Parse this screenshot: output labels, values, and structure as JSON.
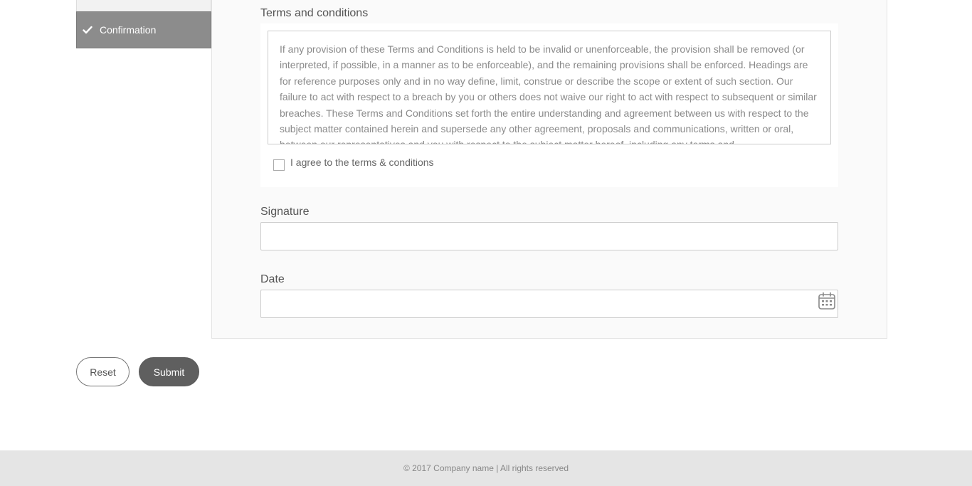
{
  "sidebar": {
    "active_item": {
      "label": "Confirmation",
      "icon": "check-icon"
    }
  },
  "terms": {
    "label": "Terms and conditions",
    "text": "If any provision of these Terms and Conditions is held to be invalid or unenforceable, the provision shall be removed (or interpreted, if possible, in a manner as to be enforceable), and the remaining provisions shall be enforced. Headings are for reference purposes only and in no way define, limit, construe or describe the scope or extent of such section. Our failure to act with respect to a breach by you or others does not waive our right to act with respect to subsequent or similar breaches. These Terms and Conditions set forth the entire understanding and agreement between us with respect to the subject matter contained herein and supersede any other agreement, proposals and communications, written or oral, between our representatives and you with respect to the subject matter hereof, including any terms and",
    "agree_label": "I agree to the terms & conditions",
    "agree_checked": false
  },
  "signature": {
    "label": "Signature",
    "value": "",
    "placeholder": ""
  },
  "date": {
    "label": "Date",
    "value": "",
    "placeholder": "",
    "icon": "calendar-icon"
  },
  "actions": {
    "reset_label": "Reset",
    "submit_label": "Submit"
  },
  "footer": {
    "text": "© 2017 Company name | All rights reserved"
  },
  "colors": {
    "sidebar_active_bg": "#8c8c8c",
    "submit_bg": "#5f5f5f",
    "footer_bg": "#e5e5e5"
  }
}
